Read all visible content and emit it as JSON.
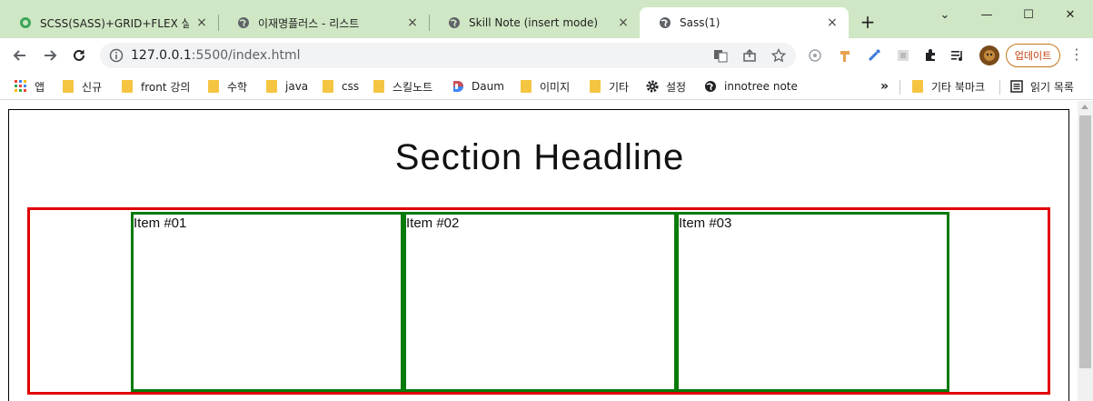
{
  "tabs": [
    {
      "title": "SCSS(SASS)+GRID+FLEX 실전",
      "favicon": "green-circle-icon",
      "close": "×"
    },
    {
      "title": "이재명플러스 - 리스트",
      "favicon": "globe-icon",
      "close": "×"
    },
    {
      "title": "Skill Note (insert mode)",
      "favicon": "globe-icon",
      "close": "×"
    },
    {
      "title": "Sass(1)",
      "favicon": "globe-icon",
      "close": "×"
    }
  ],
  "new_tab": "+",
  "window_controls": {
    "chevron": "⌄",
    "minimize": "—",
    "maximize": "☐",
    "close": "✕"
  },
  "address": {
    "host": "127.0.0.1",
    "path": ":5500/index.html"
  },
  "update_label": "업데이트",
  "bookmarks": [
    {
      "label": "앱",
      "icon": "apps-grid-icon"
    },
    {
      "label": "신규",
      "icon": "folder-icon"
    },
    {
      "label": "front 강의",
      "icon": "folder-icon"
    },
    {
      "label": "수학",
      "icon": "folder-icon"
    },
    {
      "label": "java",
      "icon": "folder-icon"
    },
    {
      "label": "css",
      "icon": "folder-icon"
    },
    {
      "label": "스킬노트",
      "icon": "folder-icon"
    },
    {
      "label": "Daum",
      "icon": "daum-icon"
    },
    {
      "label": "이미지",
      "icon": "folder-icon"
    },
    {
      "label": "기타",
      "icon": "folder-icon"
    },
    {
      "label": "설정",
      "icon": "gear-icon"
    },
    {
      "label": "innotree note",
      "icon": "globe-icon"
    }
  ],
  "bookmarks_overflow": "»",
  "other_bookmarks": "기타 북마크",
  "reading_list": "읽기 목록",
  "page": {
    "headline": "Section Headline",
    "items": [
      "Item #01",
      "Item #02",
      "Item #03"
    ]
  },
  "colors": {
    "tabstrip": "#cfe7c4",
    "grid_border": "#e00000",
    "item_border": "#087a08"
  }
}
